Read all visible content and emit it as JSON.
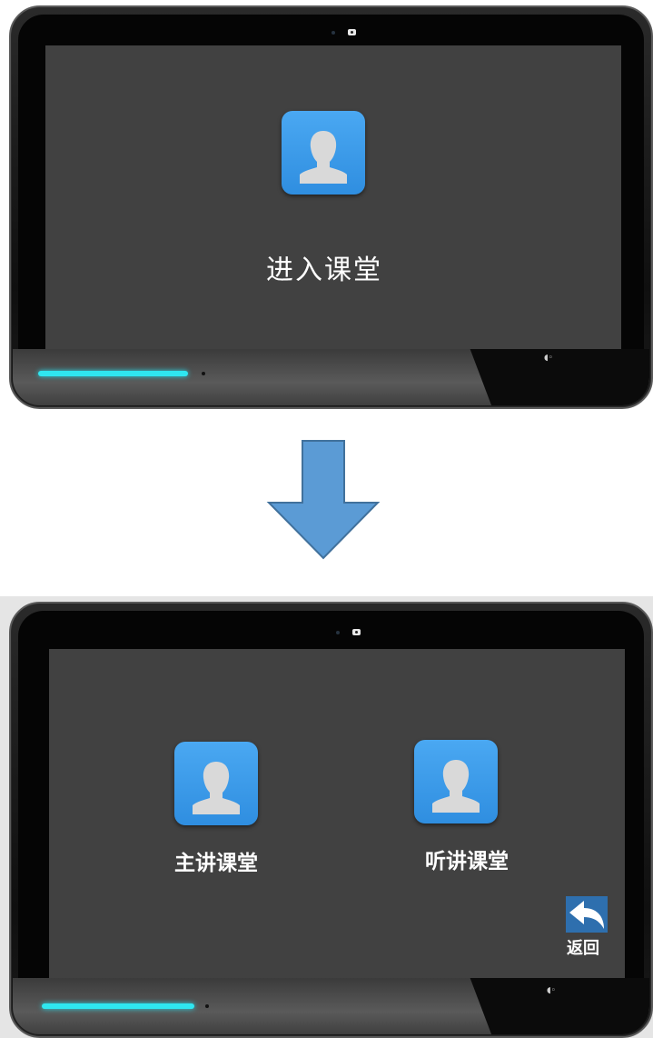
{
  "top_screen": {
    "enter_class_label": "进入课堂"
  },
  "bottom_screen": {
    "main_class_label": "主讲课堂",
    "listen_class_label": "听讲课堂",
    "back_label": "返回"
  },
  "colors": {
    "screen": "#414141",
    "icon_blue": "#3b9cea",
    "arrow_blue": "#5b9bd5",
    "led": "#2fe6f0"
  }
}
